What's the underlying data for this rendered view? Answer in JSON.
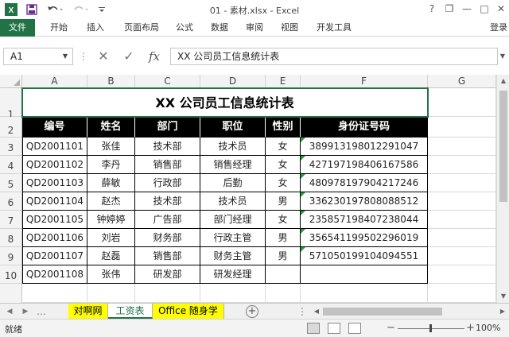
{
  "window": {
    "title": "01 - 素材.xlsx - Excel",
    "help": "?",
    "restore": "❐",
    "minimize": "—",
    "maximize": "□",
    "close": "✕"
  },
  "ribbon": {
    "tabs": [
      "文件",
      "开始",
      "插入",
      "页面布局",
      "公式",
      "数据",
      "审阅",
      "视图",
      "开发工具"
    ],
    "login": "登录"
  },
  "formula_bar": {
    "name_box": "A1",
    "cancel_icon": "✕",
    "enter_icon": "✓",
    "fx_label": "fx",
    "formula": "XX 公司员工信息统计表"
  },
  "grid": {
    "columns": [
      "A",
      "B",
      "C",
      "D",
      "E",
      "F",
      "G"
    ],
    "rows": [
      "1",
      "2",
      "3",
      "4",
      "5",
      "6",
      "7",
      "8",
      "9",
      "10"
    ],
    "sheet_title": "XX 公司员工信息统计表",
    "headers": [
      "编号",
      "姓名",
      "部门",
      "职位",
      "性别",
      "身份证号码"
    ],
    "records": [
      [
        "QD2001101",
        "张佳",
        "技术部",
        "技术员",
        "女",
        "389913198012291047"
      ],
      [
        "QD2001102",
        "李丹",
        "销售部",
        "销售经理",
        "女",
        "427197198406167586"
      ],
      [
        "QD2001103",
        "薛敏",
        "行政部",
        "后勤",
        "女",
        "480978197904217246"
      ],
      [
        "QD2001104",
        "赵杰",
        "技术部",
        "技术员",
        "男",
        "336230197808088512"
      ],
      [
        "QD2001105",
        "钟婷婷",
        "广告部",
        "部门经理",
        "女",
        "235857198407238044"
      ],
      [
        "QD2001106",
        "刘岩",
        "财务部",
        "行政主管",
        "男",
        "356541199502296019"
      ],
      [
        "QD2001107",
        "赵磊",
        "销售部",
        "财务主管",
        "男",
        "571050199104094551"
      ],
      [
        "QD2001108",
        "张伟",
        "研发部",
        "研发经理",
        "",
        ""
      ]
    ]
  },
  "sheets": {
    "tabs": [
      "对啊网",
      "工资表",
      "Office 随身学"
    ],
    "active": "工资表",
    "add": "+"
  },
  "status": {
    "text": "就绪",
    "zoom": "100%",
    "zoom_minus": "−",
    "zoom_plus": "+"
  },
  "colors": {
    "excel_green": "#217346",
    "header_bg": "#000000",
    "tab_highlight": "#ffff00"
  }
}
